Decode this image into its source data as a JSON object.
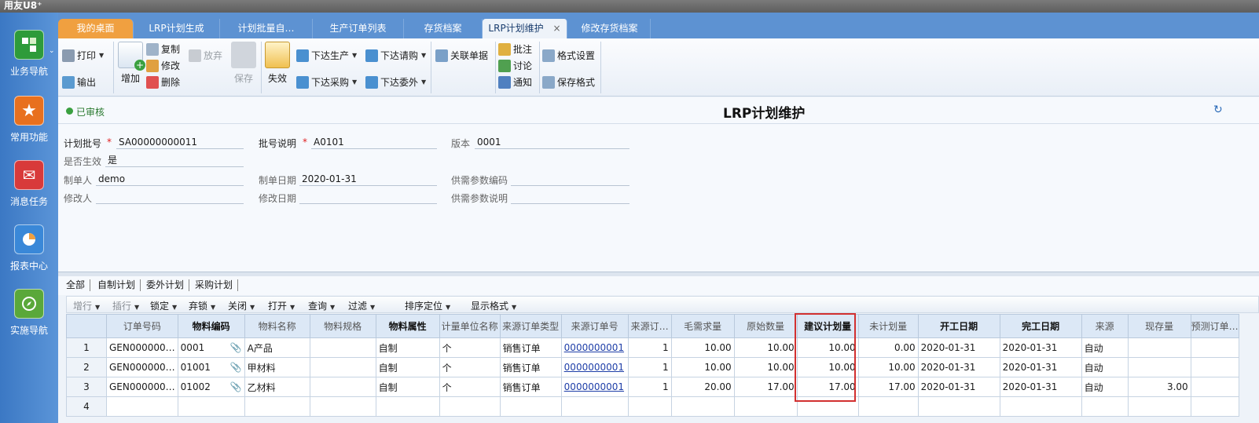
{
  "app_title": "用友U8⁺",
  "leftnav": [
    {
      "label": "业务导航",
      "icon": "business-nav-icon",
      "color": "#2e9b3a"
    },
    {
      "label": "常用功能",
      "icon": "star-icon",
      "color": "#e8701e"
    },
    {
      "label": "消息任务",
      "icon": "message-icon",
      "color": "#d83a3a"
    },
    {
      "label": "报表中心",
      "icon": "report-icon",
      "color": "#3a88d8"
    },
    {
      "label": "实施导航",
      "icon": "compass-icon",
      "color": "#5aa83a"
    }
  ],
  "tabs": [
    "我的桌面",
    "LRP计划生成",
    "计划批量自…",
    "生产订单列表",
    "存货档案",
    "LRP计划维护",
    "修改存货档案"
  ],
  "active_tab_close": "×",
  "toolbar": {
    "print": "打印",
    "export": "输出",
    "add": "增加",
    "copy": "复制",
    "modify": "修改",
    "delete": "删除",
    "abandon": "放弃",
    "save": "保存",
    "invalidate": "失效",
    "issue_production": "下达生产",
    "issue_request": "下达请购",
    "issue_purchase": "下达采购",
    "issue_outsource": "下达委外",
    "related_docs": "关联单据",
    "annotate": "批注",
    "discuss": "讨论",
    "notify": "通知",
    "format_settings": "格式设置",
    "save_format": "保存格式"
  },
  "status": "已审核",
  "page_title": "LRP计划维护",
  "form": {
    "plan_no_label": "计划批号",
    "plan_no": "SA00000000011",
    "batch_desc_label": "批号说明",
    "batch_desc": "A0101",
    "version_label": "版本",
    "version": "0001",
    "effective_label": "是否生效",
    "effective": "是",
    "creator_label": "制单人",
    "creator": "demo",
    "create_date_label": "制单日期",
    "create_date": "2020-01-31",
    "sd_param_code_label": "供需参数编码",
    "sd_param_code": "",
    "modifier_label": "修改人",
    "modifier": "",
    "modify_date_label": "修改日期",
    "modify_date": "",
    "sd_param_desc_label": "供需参数说明",
    "sd_param_desc": "",
    "required_mark": "*"
  },
  "subtabs": [
    "全部",
    "自制计划",
    "委外计划",
    "采购计划"
  ],
  "gridbar": [
    "增行",
    "插行",
    "锁定",
    "弃锁",
    "关闭",
    "打开",
    "查询",
    "过滤",
    "排序定位",
    "显示格式"
  ],
  "grid": {
    "headers": [
      "",
      "订单号码",
      "物料编码",
      "物料名称",
      "物料规格",
      "物料属性",
      "计量单位名称",
      "来源订单类型",
      "来源订单号",
      "来源订…",
      "毛需求量",
      "原始数量",
      "建议计划量",
      "未计划量",
      "开工日期",
      "完工日期",
      "来源",
      "现存量",
      "预测订单…"
    ],
    "rows": [
      [
        "1",
        "GEN000000…",
        "0001",
        "A产品",
        "",
        "自制",
        "个",
        "销售订单",
        "0000000001",
        "1",
        "10.00",
        "10.00",
        "10.00",
        "0.00",
        "2020-01-31",
        "2020-01-31",
        "自动",
        "",
        ""
      ],
      [
        "2",
        "GEN000000…",
        "01001",
        "甲材料",
        "",
        "自制",
        "个",
        "销售订单",
        "0000000001",
        "1",
        "10.00",
        "10.00",
        "10.00",
        "10.00",
        "2020-01-31",
        "2020-01-31",
        "自动",
        "",
        ""
      ],
      [
        "3",
        "GEN000000…",
        "01002",
        "乙材料",
        "",
        "自制",
        "个",
        "销售订单",
        "0000000001",
        "1",
        "20.00",
        "17.00",
        "17.00",
        "17.00",
        "2020-01-31",
        "2020-01-31",
        "自动",
        "3.00",
        ""
      ],
      [
        "4",
        "",
        "",
        "",
        "",
        "",
        "",
        "",
        "",
        "",
        "",
        "",
        "",
        "",
        "",
        "",
        "",
        "",
        ""
      ]
    ]
  }
}
